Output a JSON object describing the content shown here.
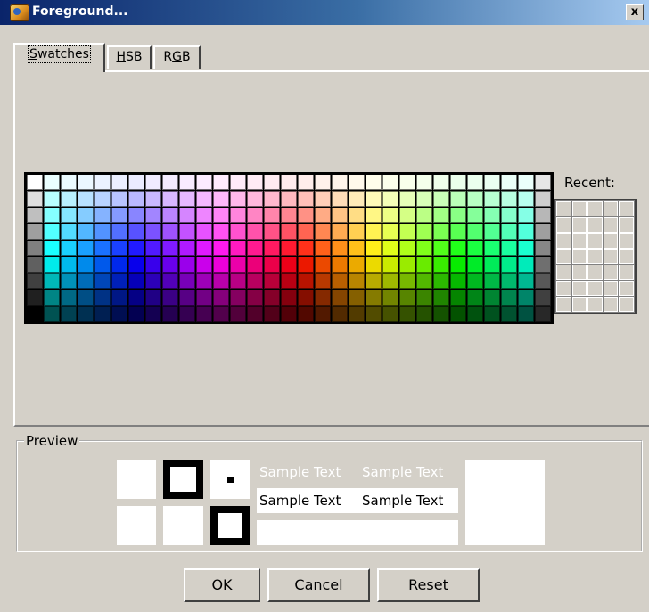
{
  "window": {
    "title": "Foreground...",
    "close_label": "x"
  },
  "tabs": [
    {
      "label": "Swatches",
      "selected": true
    },
    {
      "label": "HSB",
      "selected": false
    },
    {
      "label": "RGB",
      "selected": false
    }
  ],
  "swatches": {
    "recent_label": "Recent:",
    "recent_rows": 7,
    "recent_cols": 5
  },
  "preview": {
    "legend": "Preview",
    "sample_text": "Sample Text"
  },
  "buttons": {
    "ok": "OK",
    "cancel": "Cancel",
    "reset": "Reset"
  },
  "colors": {
    "window_bg": "#d4d0c8",
    "title_gradient_start": "#0a246a",
    "title_gradient_end": "#a6caf0"
  }
}
